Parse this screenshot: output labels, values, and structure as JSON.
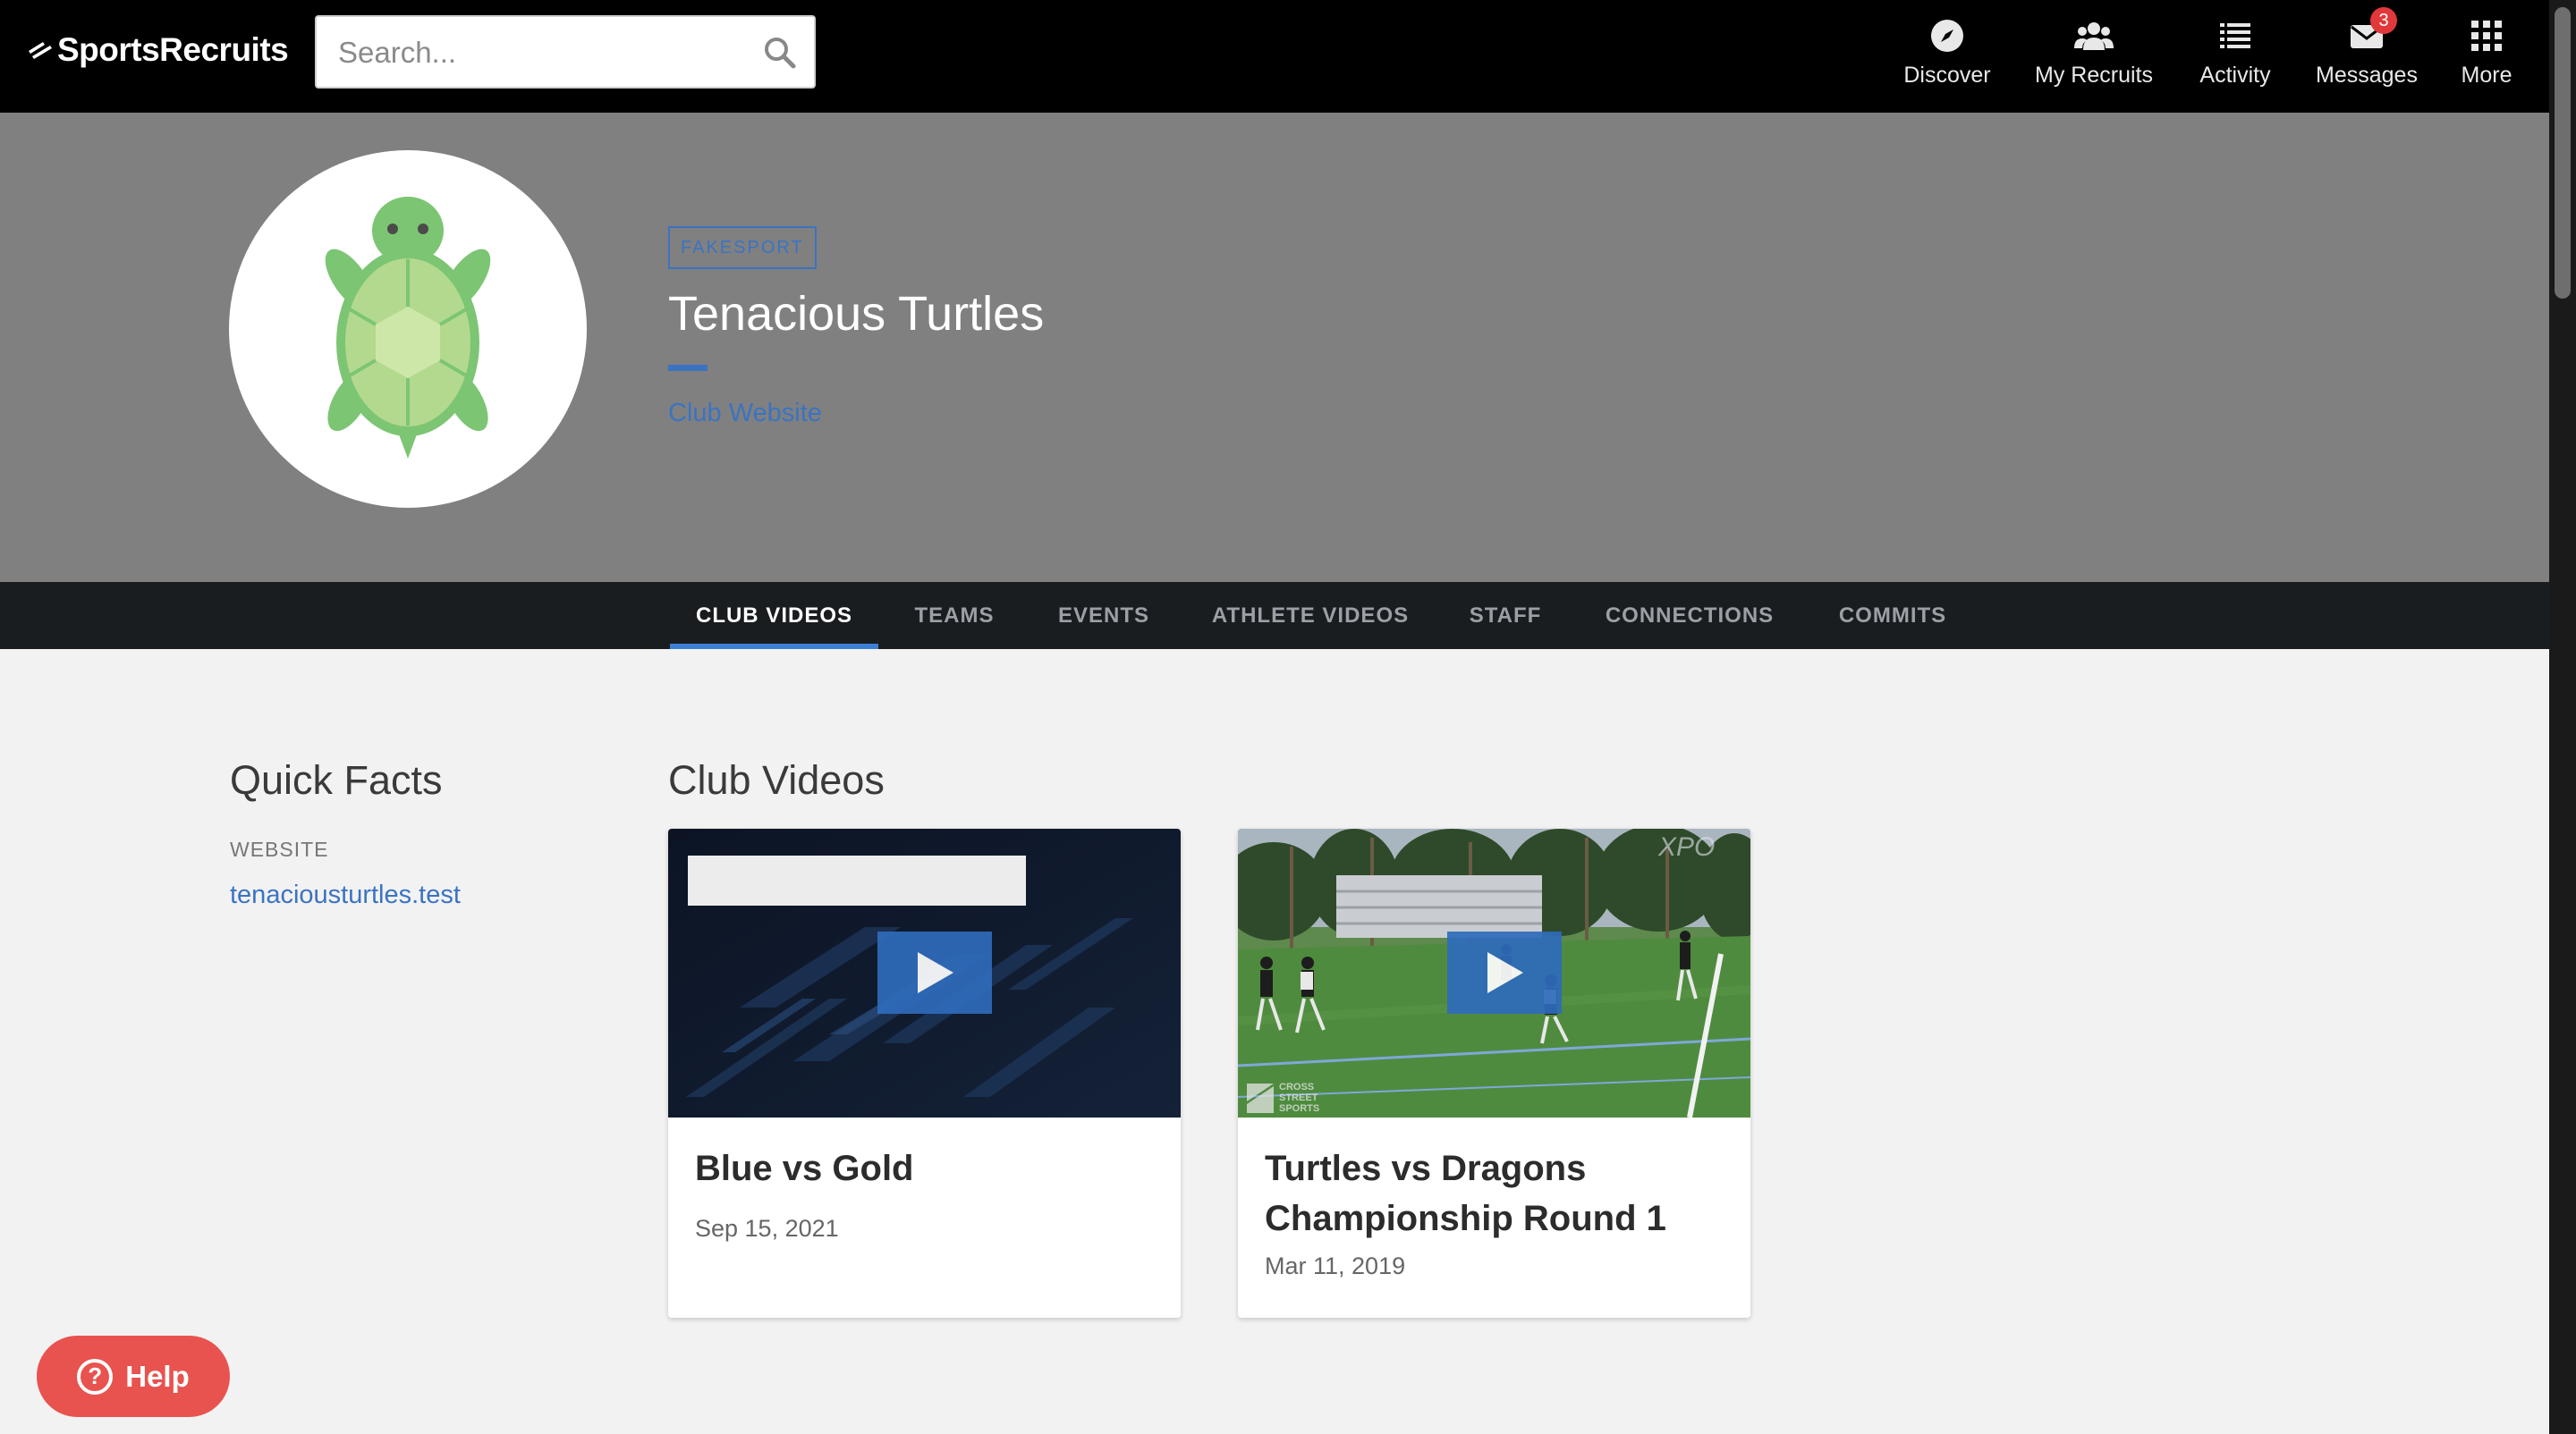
{
  "app": {
    "brand": "SportsRecruits"
  },
  "search": {
    "placeholder": "Search..."
  },
  "nav": {
    "items": [
      {
        "label": "Discover",
        "icon": "compass-icon"
      },
      {
        "label": "My Recruits",
        "icon": "people-icon"
      },
      {
        "label": "Activity",
        "icon": "list-icon"
      },
      {
        "label": "Messages",
        "icon": "envelope-icon",
        "badge": "3"
      },
      {
        "label": "More",
        "icon": "grid-icon"
      }
    ]
  },
  "club": {
    "sport": "FAKESPORT",
    "name": "Tenacious Turtles",
    "website_link": "Club Website",
    "avatar": "turtle-logo"
  },
  "tabs": [
    {
      "label": "CLUB VIDEOS",
      "active": true
    },
    {
      "label": "TEAMS"
    },
    {
      "label": "EVENTS"
    },
    {
      "label": "ATHLETE VIDEOS"
    },
    {
      "label": "STAFF"
    },
    {
      "label": "CONNECTIONS"
    },
    {
      "label": "COMMITS"
    }
  ],
  "quick_facts": {
    "title": "Quick Facts",
    "website_label": "WEBSITE",
    "website_value": "tenaciousturtles.test"
  },
  "club_videos": {
    "title": "Club Videos",
    "videos": [
      {
        "title": "Blue vs Gold",
        "date": "Sep 15, 2021"
      },
      {
        "title": "Turtles vs Dragons Championship Round 1",
        "date": "Mar 11, 2019"
      }
    ]
  },
  "help": {
    "label": "Help"
  },
  "colors": {
    "accent": "#3b73c2",
    "nav_bg": "#000000",
    "hero_bg": "#808080",
    "tabs_bg": "#1a1d20",
    "help_bg": "#e8534f",
    "badge": "#e0383b"
  }
}
